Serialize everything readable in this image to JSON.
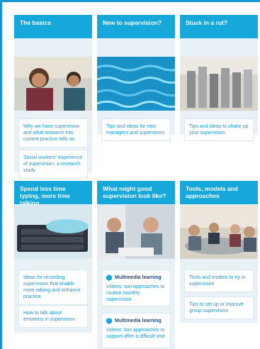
{
  "cards": [
    {
      "title": "The basics",
      "links": [
        "Why we have supervision and what research into current practice tells us",
        "Social workers' experience of supervision: a research study"
      ]
    },
    {
      "title": "New to supervision?",
      "links": [
        "Tips and ideas for new managers and supervisors"
      ]
    },
    {
      "title": "Stuck in a rut?",
      "links": [
        "Tips and ideas to shake up your supervision"
      ]
    },
    {
      "title": "Spend less time typing, more time talking",
      "links": [
        "Ideas for recording supervision that enable more talking and enhance practice",
        "How to talk about emotions in supervision"
      ]
    },
    {
      "title": "What might good supervision look like?",
      "multimedia": [
        {
          "label": "Multimedia learning",
          "text": "Videos: two approaches to routine monthly supervision"
        },
        {
          "label": "Multimedia learning",
          "text": "Videos: two approaches to support after a difficult visit"
        }
      ]
    },
    {
      "title": "Tools, models and approaches",
      "links": [
        "Tools and models to try in supervision",
        "Tips to set up or improve group supervision"
      ]
    }
  ],
  "colors": {
    "accent": "#16a8db",
    "link": "#1597d2",
    "card_bg": "#e8f1f6",
    "multimedia_title": "#1d4e7a"
  },
  "icons": {
    "multimedia": "hexagon-icon"
  }
}
